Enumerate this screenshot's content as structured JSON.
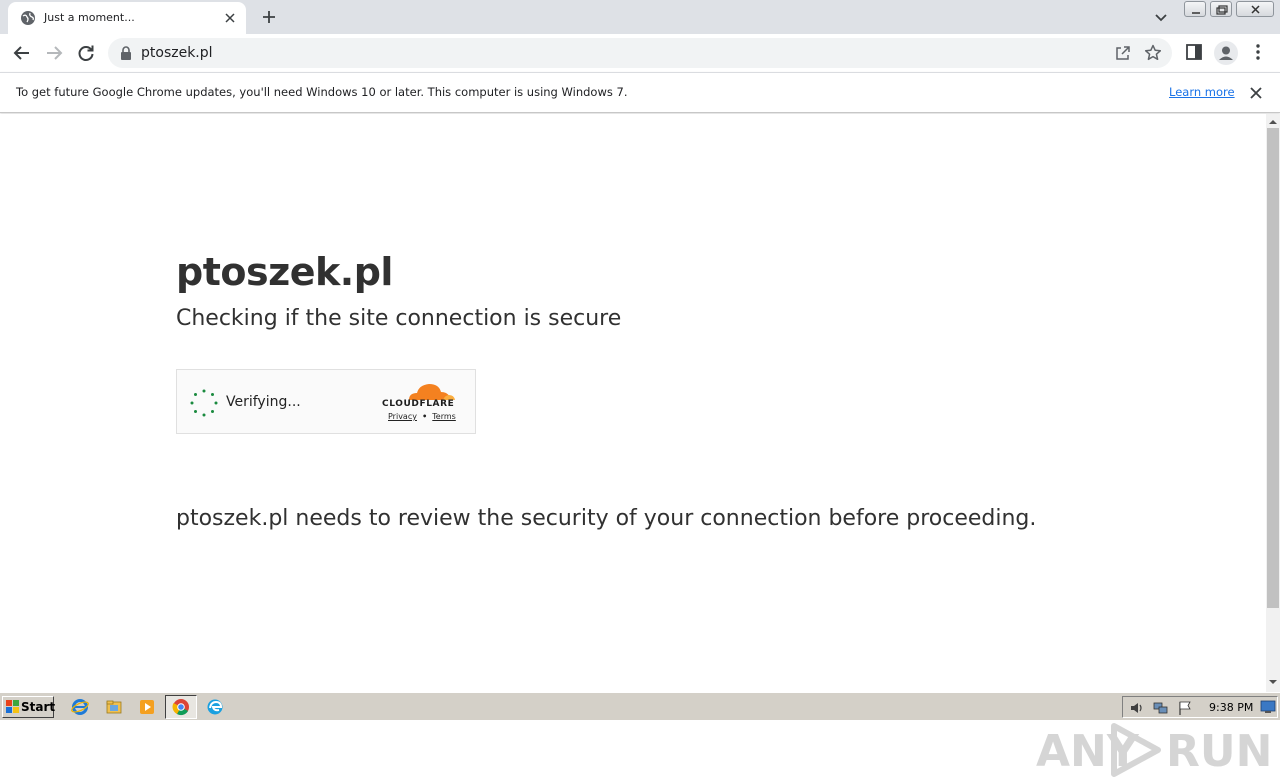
{
  "browser": {
    "tab": {
      "title": "Just a moment..."
    },
    "address": {
      "url": "ptoszek.pl"
    }
  },
  "infobar": {
    "message": "To get future Google Chrome updates, you'll need Windows 10 or later. This computer is using Windows 7.",
    "learn_more": "Learn more"
  },
  "page": {
    "heading": "ptoszek.pl",
    "subheading": "Checking if the site connection is secure",
    "widget": {
      "status": "Verifying...",
      "brand": "CLOUDFLARE",
      "privacy": "Privacy",
      "separator": "•",
      "terms": "Terms"
    },
    "review": "ptoszek.pl needs to review the security of your connection before proceeding."
  },
  "watermark": {
    "left": "ANY",
    "right": "RUN"
  },
  "taskbar": {
    "start_label": "Start",
    "clock": "9:38 PM"
  },
  "colors": {
    "cloudflare_orange": "#f48120",
    "spinner_green": "#1a8a3e",
    "link_blue": "#1a73e8"
  }
}
